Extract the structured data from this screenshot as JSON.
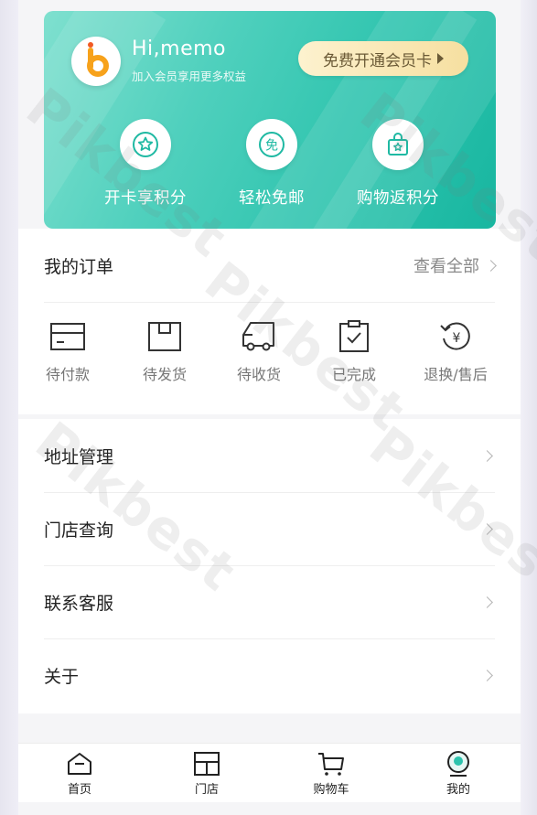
{
  "member_card": {
    "greeting": "Hi,memo",
    "subline": "加入会员享用更多权益",
    "vip_button": "免费开通会员卡",
    "benefits": [
      {
        "icon": "star-badge-icon",
        "label": "开卡享积分"
      },
      {
        "icon": "free-shipping-icon",
        "label": "轻松免邮"
      },
      {
        "icon": "shopping-bag-icon",
        "label": "购物返积分"
      }
    ]
  },
  "orders": {
    "title": "我的订单",
    "view_all": "查看全部",
    "statuses": [
      {
        "icon": "card-icon",
        "label": "待付款"
      },
      {
        "icon": "box-icon",
        "label": "待发货"
      },
      {
        "icon": "truck-icon",
        "label": "待收货"
      },
      {
        "icon": "clipboard-check-icon",
        "label": "已完成"
      },
      {
        "icon": "refund-icon",
        "label": "退换/售后"
      }
    ]
  },
  "menu": [
    {
      "label": "地址管理"
    },
    {
      "label": "门店查询"
    },
    {
      "label": "联系客服"
    },
    {
      "label": "关于"
    }
  ],
  "tabbar": [
    {
      "icon": "home-icon",
      "label": "首页"
    },
    {
      "icon": "store-icon",
      "label": "门店"
    },
    {
      "icon": "cart-icon",
      "label": "购物车"
    },
    {
      "icon": "profile-icon",
      "label": "我的"
    }
  ],
  "watermark": "Pikbest",
  "colors": {
    "card_teal": "#2cc3ad",
    "vip_gold": "#f6dfa0",
    "vip_text": "#6b5a36",
    "profile_active": "#2cc3ad"
  }
}
